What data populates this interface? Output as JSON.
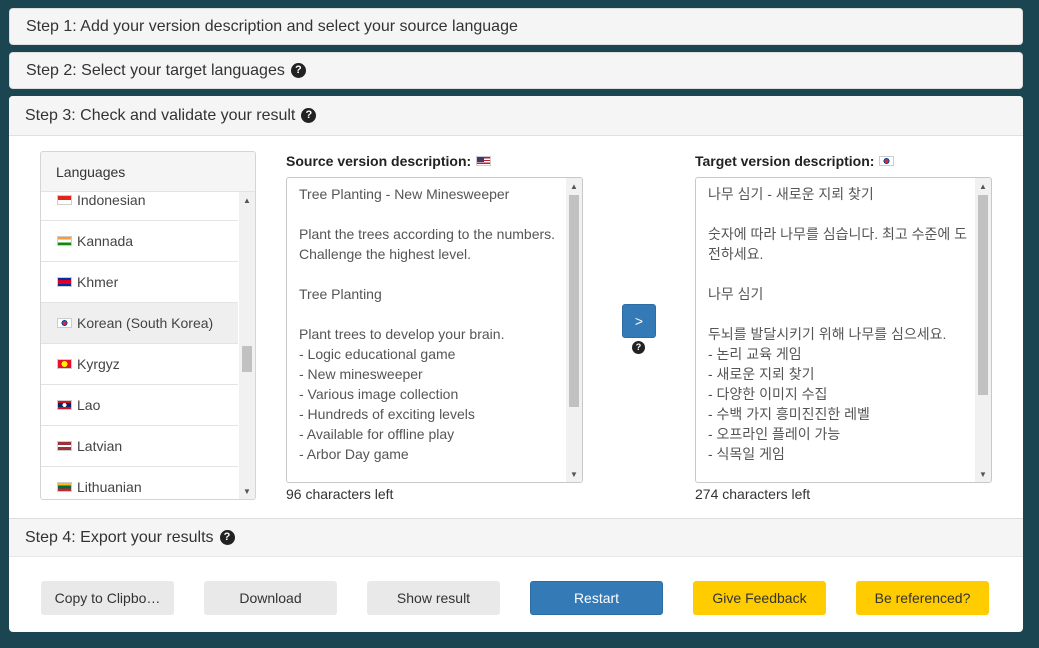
{
  "steps": {
    "step1": "Step 1: Add your version description and select your source language",
    "step2": "Step 2: Select your target languages",
    "step3": "Step 3: Check and validate your result",
    "step4": "Step 4: Export your results"
  },
  "languages": {
    "header": "Languages",
    "items": [
      {
        "label": "Indonesian",
        "flag": "indonesia-flag-icon"
      },
      {
        "label": "Kannada",
        "flag": "india-flag-icon"
      },
      {
        "label": "Khmer",
        "flag": "cambodia-flag-icon"
      },
      {
        "label": "Korean (South Korea)",
        "flag": "south-korea-flag-icon",
        "selected": true
      },
      {
        "label": "Kyrgyz",
        "flag": "kyrgyzstan-flag-icon"
      },
      {
        "label": "Lao",
        "flag": "laos-flag-icon"
      },
      {
        "label": "Latvian",
        "flag": "latvia-flag-icon"
      },
      {
        "label": "Lithuanian",
        "flag": "lithuania-flag-icon"
      }
    ]
  },
  "source": {
    "label": "Source version description:",
    "flag": "us-flag-icon",
    "text": "Tree Planting - New Minesweeper\n\nPlant the trees according to the numbers. Challenge the highest level.\n\nTree Planting\n\nPlant trees to develop your brain.\n- Logic educational game\n- New minesweeper\n- Various image collection\n- Hundreds of exciting levels\n- Available for offline play\n- Arbor Day game",
    "chars_left": "96 characters left"
  },
  "target": {
    "label": "Target version description:",
    "flag": "south-korea-flag-icon",
    "text": "나무 심기 - 새로운 지뢰 찾기\n\n숫자에 따라 나무를 심습니다. 최고 수준에 도전하세요.\n\n나무 심기\n\n두뇌를 발달시키기 위해 나무를 심으세요.\n- 논리 교육 게임\n- 새로운 지뢰 찾기\n- 다양한 이미지 수집\n- 수백 가지 흥미진진한 레벨\n- 오프라인 플레이 가능\n- 식목일 게임",
    "chars_left": "274 characters left"
  },
  "translate_button": ">",
  "buttons": {
    "copy": "Copy to Clipbo…",
    "download": "Download",
    "show_result": "Show result",
    "restart": "Restart",
    "feedback": "Give Feedback",
    "referenced": "Be referenced?"
  },
  "colors": {
    "background": "#1b4651",
    "primary": "#337ab7",
    "accent": "#ffcc00"
  }
}
